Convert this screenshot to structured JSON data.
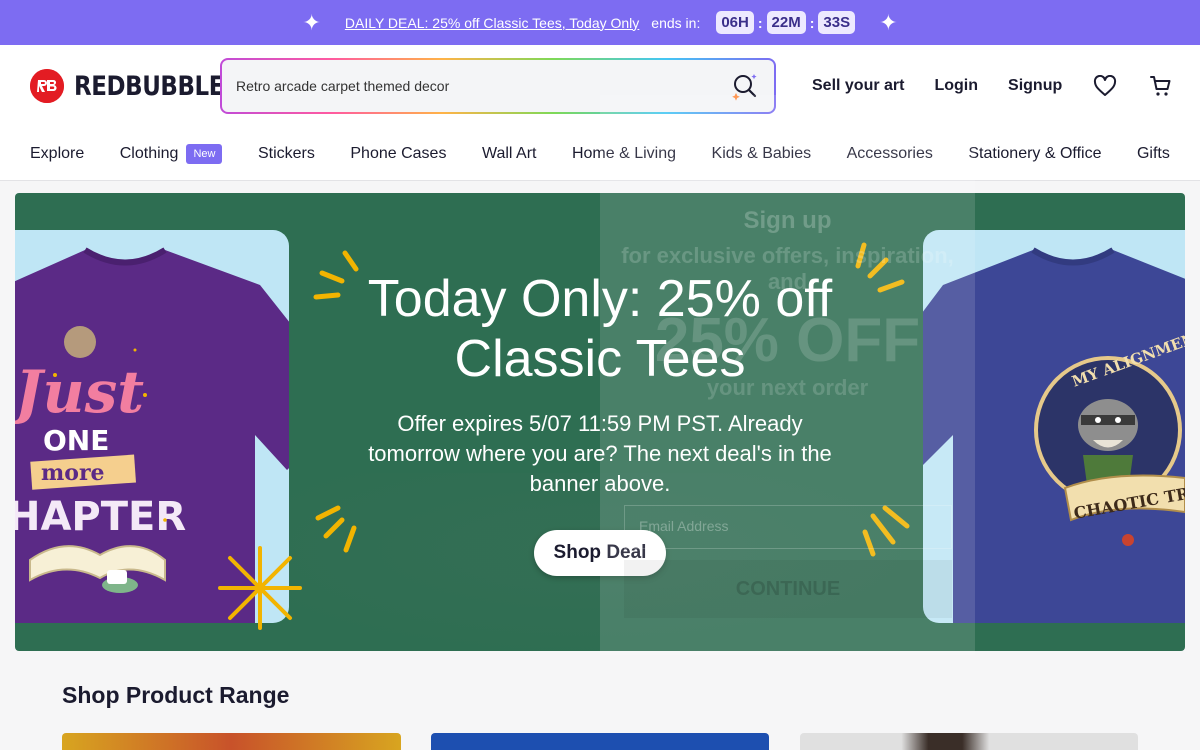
{
  "promo": {
    "deal_text": "DAILY DEAL: 25% off Classic Tees, Today Only",
    "ends_label": "ends in:",
    "hours": "06H",
    "minutes": "22M",
    "seconds": "33S"
  },
  "header": {
    "logo_text": "REDBUBBLE",
    "search_value": "Retro arcade carpet themed decor",
    "sell_label": "Sell your art",
    "login_label": "Login",
    "signup_label": "Signup"
  },
  "nav": {
    "items": [
      "Explore",
      "Clothing",
      "Stickers",
      "Phone Cases",
      "Wall Art",
      "Home & Living",
      "Kids & Babies",
      "Accessories",
      "Stationery & Office",
      "Gifts"
    ],
    "new_badge": "New"
  },
  "hero": {
    "title": "Today Only: 25% off Classic Tees",
    "subtitle": "Offer expires 5/07 11:59 PM PST. Already tomorrow where you are? The next deal's in the banner above.",
    "cta_label": "Shop Deal",
    "left_tee_text": "Just ONE more CHAPTER",
    "right_tee_text": "MY ALIGNMENT? CHAOTIC TRASH"
  },
  "ghost_modal": {
    "heading": "Sign up",
    "subheading": "for exclusive offers, inspiration, and",
    "discount": "25% OFF",
    "next_order": "your next order",
    "email_placeholder": "Email Address",
    "continue_label": "CONTINUE"
  },
  "product_range": {
    "title": "Shop Product Range"
  },
  "colors": {
    "promo_bg": "#7d6cf2",
    "hero_bg": "#2e6e52",
    "brand_red": "#e31c23"
  }
}
